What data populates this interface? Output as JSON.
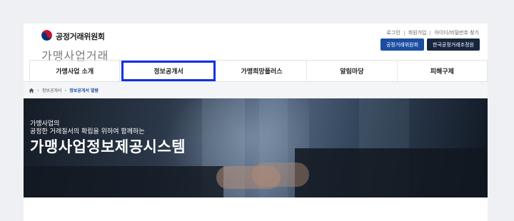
{
  "header": {
    "org_name": "공정거래위원회",
    "site_name": "가맹사업거래",
    "util_links": [
      {
        "label": "로그인"
      },
      {
        "label": "회원가입"
      },
      {
        "label": "아이디/비밀번호 찾기"
      }
    ],
    "buttons": [
      {
        "label": "공정거래위원회"
      },
      {
        "label": "한국공정거래조정원"
      }
    ]
  },
  "nav": {
    "items": [
      {
        "label": "가맹사업 소개"
      },
      {
        "label": "정보공개서"
      },
      {
        "label": "가맹희망플러스"
      },
      {
        "label": "알림마당"
      },
      {
        "label": "피해구제"
      }
    ],
    "active_index": 1
  },
  "breadcrumb": {
    "items": [
      {
        "label": "정보공개서"
      },
      {
        "label": "정보공개서 열람"
      }
    ]
  },
  "hero": {
    "line1": "가맹사업의",
    "line2": "공정한 거래질서의 확립을 위하여 함께하는",
    "title": "가맹사업정보제공시스템"
  },
  "colors": {
    "accent_blue": "#1a4ea1",
    "active_tab_border": "#1030e6",
    "navy": "#17263f"
  },
  "icons": {
    "emblem": "taegeuk-emblem-icon",
    "home": "home-icon",
    "chevron": "chevron-right-icon"
  }
}
